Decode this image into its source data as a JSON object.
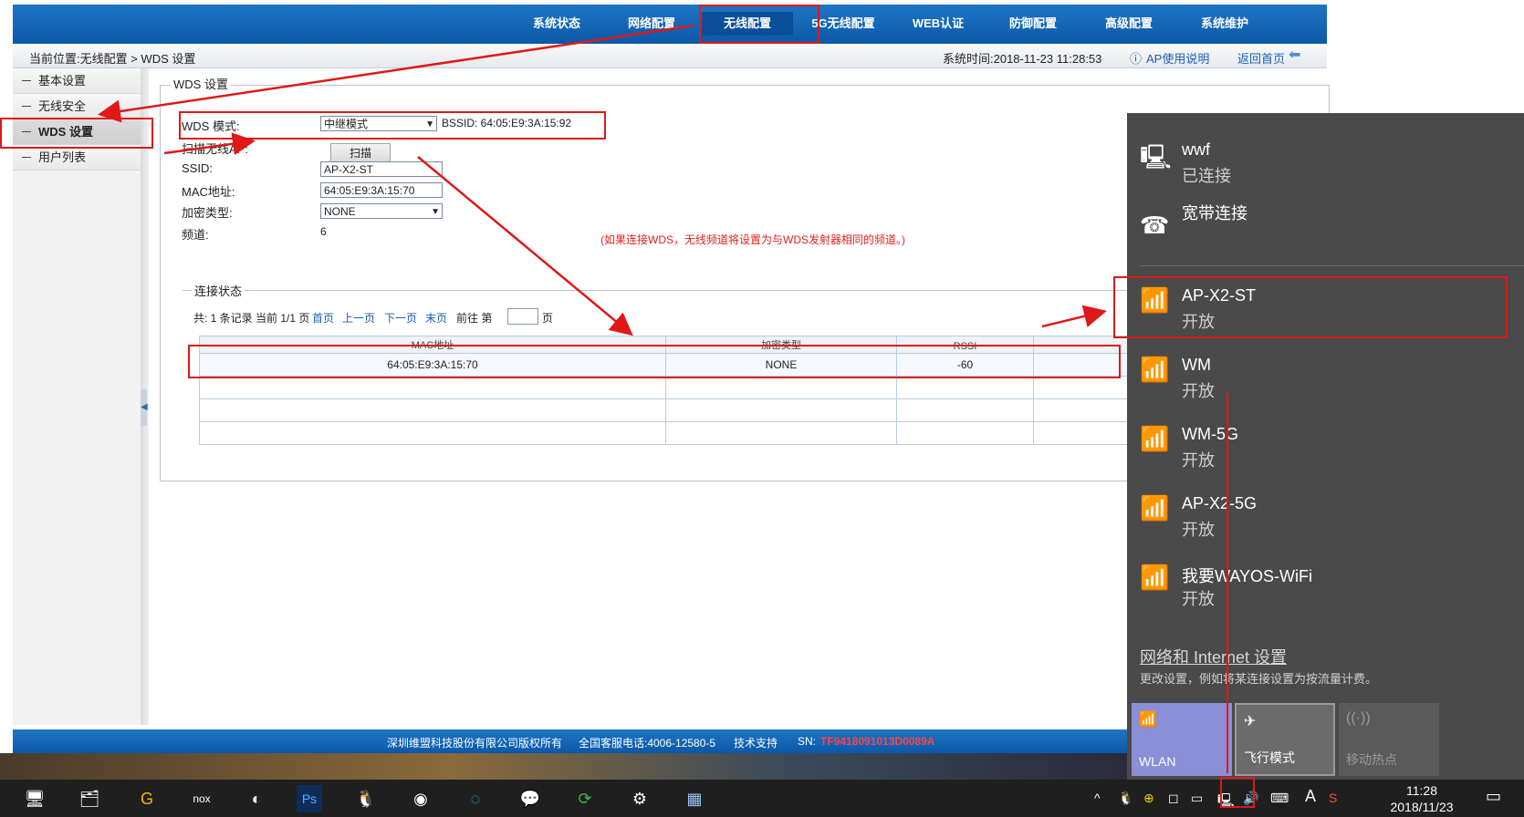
{
  "nav": {
    "items": [
      {
        "label": "系统状态"
      },
      {
        "label": "网络配置"
      },
      {
        "label": "无线配置",
        "active": true
      },
      {
        "label": "5G无线配置"
      },
      {
        "label": "WEB认证"
      },
      {
        "label": "防御配置"
      },
      {
        "label": "高级配置"
      },
      {
        "label": "系统维护"
      }
    ]
  },
  "breadcrumb": {
    "text": "当前位置:无线配置 > WDS 设置",
    "system_time": "系统时间:2018-11-23 11:28:53",
    "help": "AP使用说明",
    "home": "返回首页"
  },
  "sidebar": {
    "items": [
      {
        "label": "基本设置"
      },
      {
        "label": "无线安全"
      },
      {
        "label": "WDS 设置",
        "active": true
      },
      {
        "label": "用户列表"
      }
    ]
  },
  "wds": {
    "legend": "WDS 设置",
    "mode_label": "WDS 模式:",
    "mode_value": "中继模式",
    "bssid": "BSSID: 64:05:E9:3A:15:92",
    "scan_label": "扫描无线AP:",
    "scan_button": "扫描",
    "ssid_label": "SSID:",
    "ssid_value": "AP-X2-ST",
    "mac_label": "MAC地址:",
    "mac_value": "64:05:E9:3A:15:70",
    "enc_label": "加密类型:",
    "enc_value": "NONE",
    "channel_label": "频道:",
    "channel_value": "6",
    "note": "(如果连接WDS，无线频道将设置为与WDS发射器相同的频道。)"
  },
  "status": {
    "legend": "连接状态",
    "summary": "共: 1 条记录 当前 1/1 页",
    "first": "首页",
    "prev": "上一页",
    "next": "下一页",
    "last": "末页",
    "goto": "前往 第",
    "page_unit": "页",
    "headers": [
      "MAC地址",
      "加密类型",
      "RSSI",
      ""
    ],
    "rows": [
      [
        "64:05:E9:3A:15:70",
        "NONE",
        "-60",
        ""
      ],
      [
        "",
        "",
        "",
        ""
      ],
      [
        "",
        "",
        "",
        ""
      ],
      [
        "",
        "",
        "",
        ""
      ]
    ]
  },
  "footer": {
    "copyright": "深圳维盟科技股份有限公司版权所有",
    "hotline": "全国客服电话:4006-12580-5",
    "support": "技术支持",
    "sn_label": "SN:",
    "sn_value": "TF9418091013D0089A"
  },
  "flyout": {
    "networks": [
      {
        "name": "wwf",
        "status": "已连接",
        "icon": "ethernet-icon"
      },
      {
        "name": "宽带连接",
        "status": "",
        "icon": "dialup-icon"
      },
      {
        "name": "AP-X2-ST",
        "status": "开放",
        "icon": "wifi-open-icon"
      },
      {
        "name": "WM",
        "status": "开放",
        "icon": "wifi-open-icon"
      },
      {
        "name": "WM-5G",
        "status": "开放",
        "icon": "wifi-open-icon"
      },
      {
        "name": "AP-X2-5G",
        "status": "开放",
        "icon": "wifi-open-icon"
      },
      {
        "name": "我要WAYOS-WiFi",
        "status": "开放",
        "icon": "wifi-open-icon"
      }
    ],
    "settings_link": "网络和 Internet 设置",
    "settings_sub": "更改设置，例如将某连接设置为按流量计费。",
    "tiles": [
      {
        "label": "WLAN",
        "active": true
      },
      {
        "label": "飞行模式",
        "active": false
      },
      {
        "label": "移动热点",
        "active": false
      }
    ]
  },
  "taskbar": {
    "time": "11:28",
    "date": "2018/11/23",
    "ime": "A"
  },
  "colors": {
    "nav_blue": "#0b58a8",
    "annotation_red": "#e01818",
    "flyout_bg": "#4a4a4a",
    "wlan_tile": "#8a8fd6"
  }
}
